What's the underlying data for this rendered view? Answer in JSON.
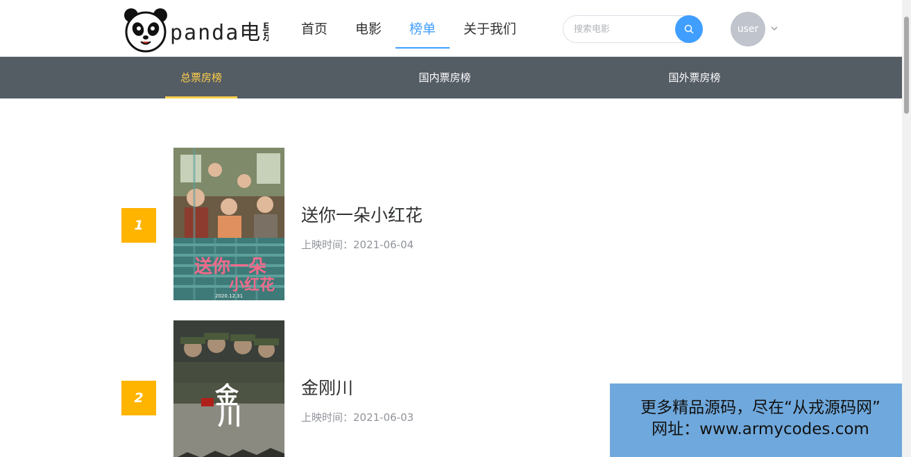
{
  "header": {
    "logo_text": "panda电影",
    "nav": [
      {
        "label": "首页"
      },
      {
        "label": "电影"
      },
      {
        "label": "榜单",
        "active": true
      },
      {
        "label": "关于我们"
      }
    ],
    "search": {
      "placeholder": "搜索电影",
      "value": ""
    },
    "user": {
      "name": "user"
    }
  },
  "subnav": [
    {
      "label": "总票房榜",
      "active": true
    },
    {
      "label": "国内票房榜"
    },
    {
      "label": "国外票房榜"
    }
  ],
  "movies": [
    {
      "rank": "1",
      "title": "送你一朵小红花",
      "date": "上映时间：2021-06-04",
      "poster_caption": "2020.12.31"
    },
    {
      "rank": "2",
      "title": "金刚川",
      "date": "上映时间：2021-06-03"
    }
  ],
  "banner": {
    "line1": "更多精品源码，尽在“从戎源码网”",
    "line2": "网址：www.armycodes.com"
  },
  "colors": {
    "accent": "#409eff",
    "subnav_bg": "#545c64",
    "subnav_active": "#ffd04b",
    "rank_badge": "#ffb400",
    "banner_bg": "#6fa8dc"
  },
  "icons": {
    "search": "search-icon",
    "caret": "chevron-down-icon",
    "logo": "panda-icon"
  }
}
